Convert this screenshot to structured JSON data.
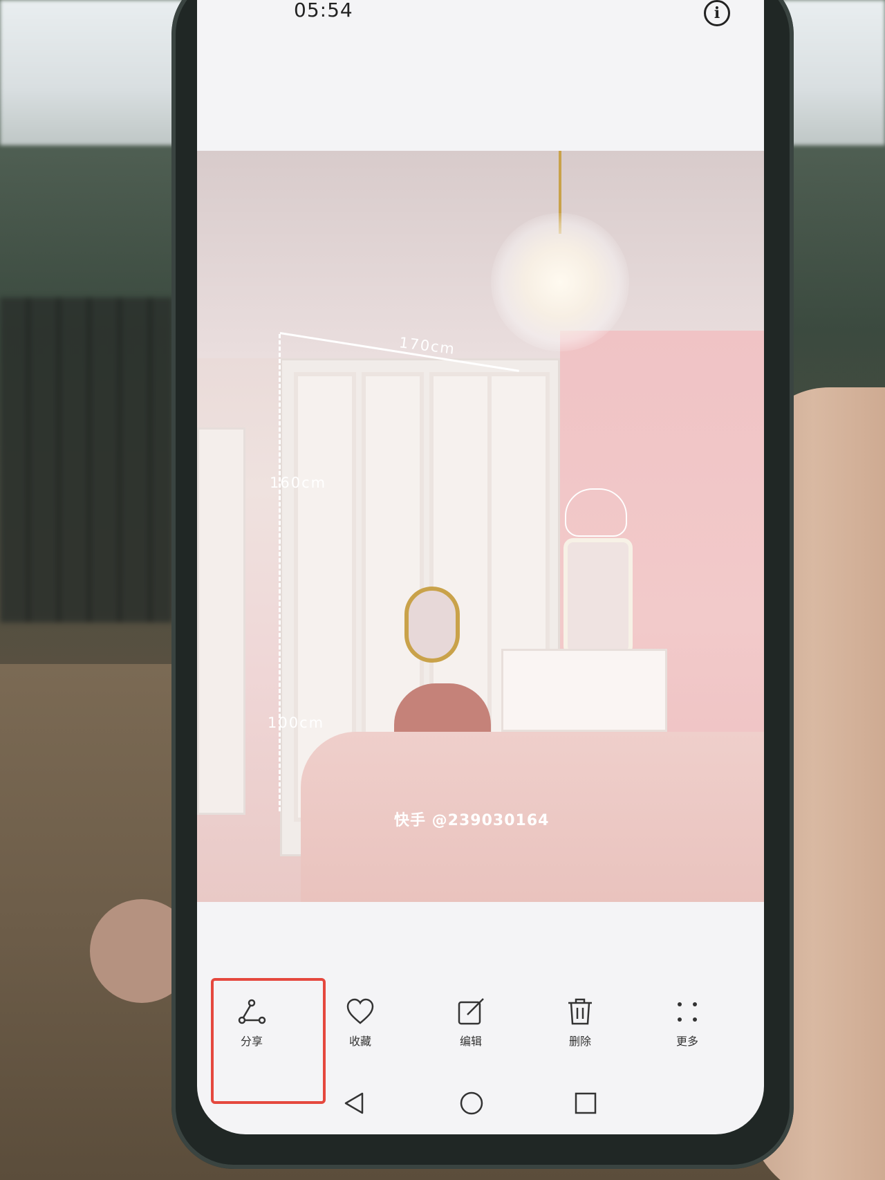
{
  "status_bar": {
    "time": "05:54"
  },
  "photo": {
    "dimensions": {
      "width": "170cm",
      "upper_height": "160cm",
      "lower_height": "100cm"
    },
    "watermark": "快手 @239030164"
  },
  "toolbar": {
    "items": [
      {
        "label": "分享",
        "icon": "share-icon"
      },
      {
        "label": "收藏",
        "icon": "heart-icon"
      },
      {
        "label": "编辑",
        "icon": "edit-icon"
      },
      {
        "label": "删除",
        "icon": "trash-icon"
      },
      {
        "label": "更多",
        "icon": "more-icon"
      }
    ]
  },
  "navigation": {
    "buttons": [
      "back-icon",
      "home-icon",
      "recents-icon"
    ]
  },
  "annotation": {
    "highlight_color": "#e5483e"
  }
}
